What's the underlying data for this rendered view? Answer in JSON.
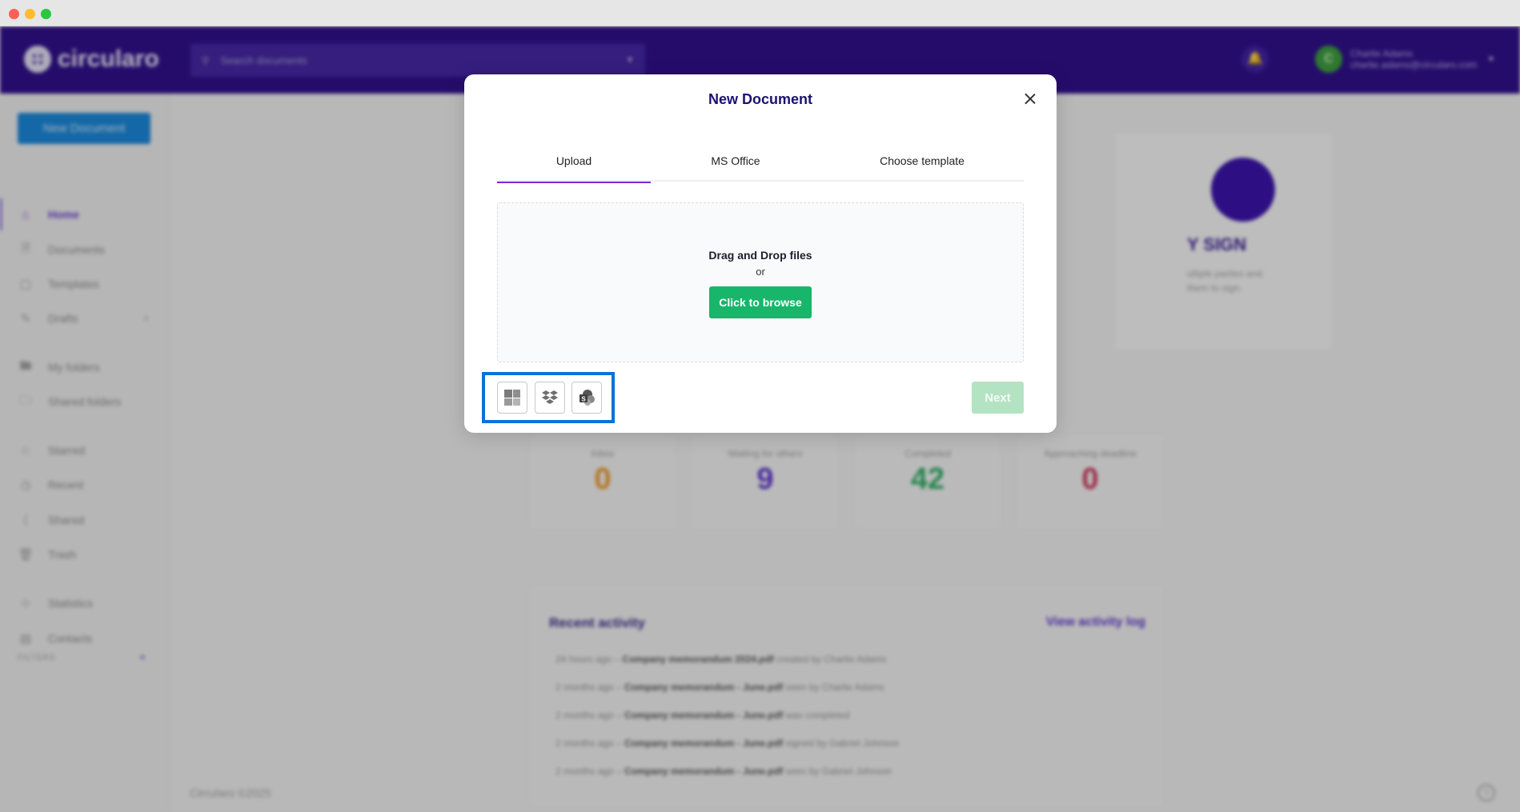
{
  "window": {
    "controls": [
      "close",
      "minimize",
      "maximize"
    ]
  },
  "header": {
    "logo_text": "circularo",
    "search_placeholder": "Search documents",
    "user_initial": "C",
    "user_name": "Charlie Adams",
    "user_email": "charlie.adams@circularo.com"
  },
  "sidebar": {
    "new_document_label": "New Document",
    "items": [
      {
        "label": "Home",
        "icon": "home-icon",
        "active": true
      },
      {
        "label": "Documents",
        "icon": "document-icon"
      },
      {
        "label": "Templates",
        "icon": "template-icon"
      },
      {
        "label": "Drafts",
        "icon": "edit-icon"
      },
      {
        "label": "My folders",
        "icon": "folder-icon"
      },
      {
        "label": "Shared folders",
        "icon": "shared-folder-icon"
      },
      {
        "label": "Starred",
        "icon": "star-icon"
      },
      {
        "label": "Recent",
        "icon": "clock-icon"
      },
      {
        "label": "Shared",
        "icon": "share-icon"
      },
      {
        "label": "Trash",
        "icon": "trash-icon"
      },
      {
        "label": "Statistics",
        "icon": "chart-icon"
      },
      {
        "label": "Contacts",
        "icon": "contacts-icon"
      }
    ],
    "filters_label": "FILTERS"
  },
  "dashboard": {
    "sign_card": {
      "title": "Y SIGN",
      "desc_line1": "ultiple parties and",
      "desc_line2": "them to sign."
    },
    "stats": [
      {
        "label": "Inbox",
        "value": "0",
        "color": "#e8952a"
      },
      {
        "label": "Waiting for others",
        "value": "9",
        "color": "#5b35c9"
      },
      {
        "label": "Completed",
        "value": "42",
        "color": "#2fa862"
      },
      {
        "label": "Approaching deadline",
        "value": "0",
        "color": "#c8375a"
      }
    ],
    "activity": {
      "title": "Recent activity",
      "link": "View activity log",
      "rows": [
        {
          "time": "24 hours ago",
          "doc": "Company memorandum 2024.pdf",
          "action": "created by Charlie Adams"
        },
        {
          "time": "2 months ago",
          "doc": "Company memorandum - June.pdf",
          "action": "seen by Charlie Adams"
        },
        {
          "time": "2 months ago",
          "doc": "Company memorandum - June.pdf",
          "action": "was completed"
        },
        {
          "time": "2 months ago",
          "doc": "Company memorandum - June.pdf",
          "action": "signed by Gabriel Johnson"
        },
        {
          "time": "2 months ago",
          "doc": "Company memorandum - June.pdf",
          "action": "seen by Gabriel Johnson"
        }
      ]
    },
    "footer": "Circularo ©2025"
  },
  "modal": {
    "title": "New Document",
    "tabs": [
      {
        "label": "Upload",
        "active": true
      },
      {
        "label": "MS Office"
      },
      {
        "label": "Choose template"
      }
    ],
    "dropzone": {
      "title": "Drag and Drop files",
      "or": "or",
      "browse_label": "Click to browse"
    },
    "cloud_sources": [
      "onedrive-icon",
      "dropbox-icon",
      "sharepoint-icon"
    ],
    "next_label": "Next"
  },
  "colors": {
    "brand_purple": "#30108a",
    "accent_green": "#17b66a",
    "highlight_blue": "#0a72d8",
    "tab_underline": "#7a2bd8"
  }
}
